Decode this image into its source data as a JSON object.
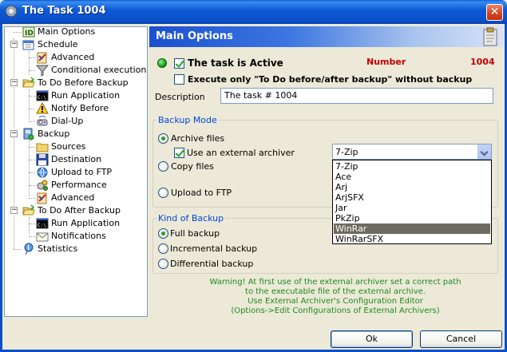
{
  "window": {
    "title": "The Task 1004",
    "close_glyph": "✕"
  },
  "tree": {
    "items": [
      {
        "label": "Main Options",
        "icon": "id-icon"
      },
      {
        "label": "Schedule",
        "icon": "calendar-icon"
      },
      {
        "label": "Advanced",
        "icon": "advanced-icon"
      },
      {
        "label": "Conditional execution",
        "icon": "filter-icon"
      },
      {
        "label": "To Do Before Backup",
        "icon": "folder-open-icon"
      },
      {
        "label": "Run Application",
        "icon": "console-icon"
      },
      {
        "label": "Notify Before",
        "icon": "warning-icon"
      },
      {
        "label": "Dial-Up",
        "icon": "dialup-icon"
      },
      {
        "label": "Backup",
        "icon": "backup-icon"
      },
      {
        "label": "Sources",
        "icon": "folder-icon"
      },
      {
        "label": "Destination",
        "icon": "disk-icon"
      },
      {
        "label": "Upload to FTP",
        "icon": "ftp-icon"
      },
      {
        "label": "Performance",
        "icon": "performance-icon"
      },
      {
        "label": "Advanced",
        "icon": "advanced-icon"
      },
      {
        "label": "To Do After Backup",
        "icon": "folder-open-icon"
      },
      {
        "label": "Run Application",
        "icon": "console-icon"
      },
      {
        "label": "Notifications",
        "icon": "envelope-icon"
      },
      {
        "label": "Statistics",
        "icon": "statistics-icon"
      }
    ]
  },
  "main": {
    "header": "Main Options",
    "active_label": "The task is Active",
    "number_label": "Number",
    "number_value": "1004",
    "execute_only_label": "Execute only \"To Do before/after backup\" without backup",
    "description_label": "Description",
    "description_value": "The task # 1004"
  },
  "backup_mode": {
    "title": "Backup Mode",
    "archive_files": "Archive files",
    "use_external": "Use an external archiver",
    "copy_files": "Copy files",
    "upload_ftp": "Upload to FTP",
    "archiver_selected": "7-Zip",
    "archiver_options": [
      "7-Zip",
      "Ace",
      "Arj",
      "ArjSFX",
      "Jar",
      "PkZip",
      "WinRar",
      "WinRarSFX"
    ],
    "highlighted_option": "WinRar"
  },
  "kind_of_backup": {
    "title": "Kind of Backup",
    "full": "Full backup",
    "incremental": "Incremental backup",
    "differential": "Differential backup"
  },
  "warning": {
    "line1": "Warning! At first use of the external archiver set a correct path",
    "line2": "to the executable file of the external archive.",
    "line3": "Use External Archiver's Configuration Editor",
    "line4": "(Options->Edit Configurations of External Archivers)"
  },
  "buttons": {
    "ok": "Ok",
    "cancel": "Cancel"
  },
  "colors": {
    "accent": "#0A4FC8",
    "number": "#C00000",
    "warning": "#1E8A1E"
  }
}
